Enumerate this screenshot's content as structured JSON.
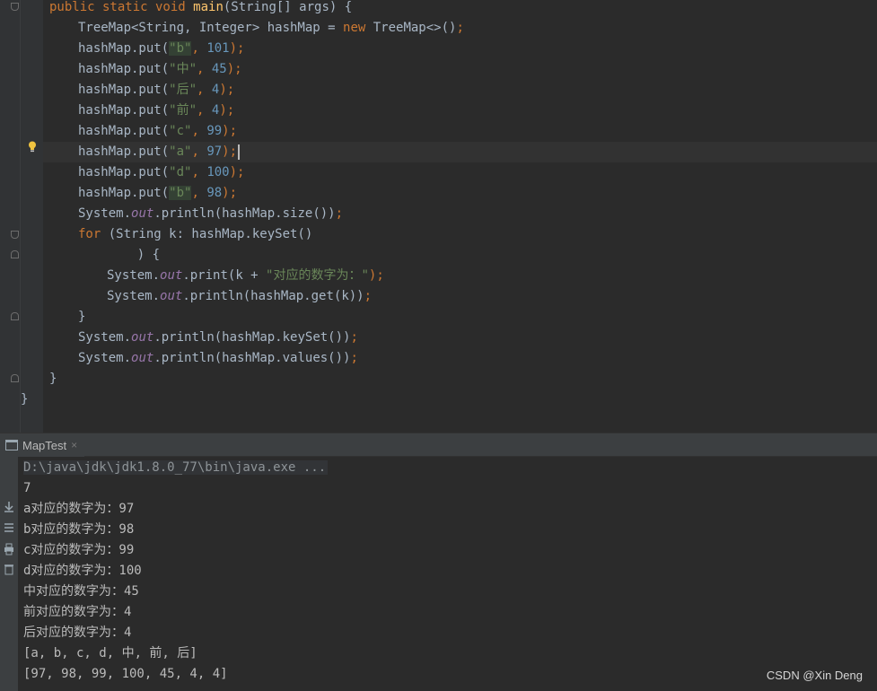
{
  "editor": {
    "lines": [
      [
        {
          "t": "public static void ",
          "c": "kw"
        },
        {
          "t": "main",
          "c": "fn"
        },
        {
          "t": "(String[] args) {",
          "c": "pl"
        }
      ],
      [
        {
          "t": "TreeMap<String, Integer> hashMap = ",
          "c": "pl"
        },
        {
          "t": "new ",
          "c": "kw"
        },
        {
          "t": "TreeMap<>()",
          "c": "pl"
        },
        {
          "t": ";",
          "c": "kw"
        }
      ],
      [
        {
          "t": "hashMap.put(",
          "c": "pl"
        },
        {
          "t": "\"b\"",
          "c": "str",
          "hl": true
        },
        {
          "t": ", ",
          "c": "kw"
        },
        {
          "t": "101",
          "c": "num"
        },
        {
          "t": ");",
          "c": "kw"
        }
      ],
      [
        {
          "t": "hashMap.put(",
          "c": "pl"
        },
        {
          "t": "\"中\"",
          "c": "str"
        },
        {
          "t": ", ",
          "c": "kw"
        },
        {
          "t": "45",
          "c": "num"
        },
        {
          "t": ");",
          "c": "kw"
        }
      ],
      [
        {
          "t": "hashMap.put(",
          "c": "pl"
        },
        {
          "t": "\"后\"",
          "c": "str"
        },
        {
          "t": ", ",
          "c": "kw"
        },
        {
          "t": "4",
          "c": "num"
        },
        {
          "t": ");",
          "c": "kw"
        }
      ],
      [
        {
          "t": "hashMap.put(",
          "c": "pl"
        },
        {
          "t": "\"前\"",
          "c": "str"
        },
        {
          "t": ", ",
          "c": "kw"
        },
        {
          "t": "4",
          "c": "num"
        },
        {
          "t": ");",
          "c": "kw"
        }
      ],
      [
        {
          "t": "hashMap.put(",
          "c": "pl"
        },
        {
          "t": "\"c\"",
          "c": "str"
        },
        {
          "t": ", ",
          "c": "kw"
        },
        {
          "t": "99",
          "c": "num"
        },
        {
          "t": ");",
          "c": "kw"
        }
      ],
      [
        {
          "t": "hashMap.put(",
          "c": "pl"
        },
        {
          "t": "\"a\"",
          "c": "str"
        },
        {
          "t": ", ",
          "c": "kw"
        },
        {
          "t": "97",
          "c": "num"
        },
        {
          "t": ");",
          "c": "kw"
        }
      ],
      [
        {
          "t": "hashMap.put(",
          "c": "pl"
        },
        {
          "t": "\"d\"",
          "c": "str"
        },
        {
          "t": ", ",
          "c": "kw"
        },
        {
          "t": "100",
          "c": "num"
        },
        {
          "t": ");",
          "c": "kw"
        }
      ],
      [
        {
          "t": "hashMap.put(",
          "c": "pl"
        },
        {
          "t": "\"b\"",
          "c": "str",
          "hl": true
        },
        {
          "t": ", ",
          "c": "kw"
        },
        {
          "t": "98",
          "c": "num"
        },
        {
          "t": ");",
          "c": "kw"
        }
      ],
      [
        {
          "t": "System.",
          "c": "pl"
        },
        {
          "t": "out",
          "c": "fld"
        },
        {
          "t": ".println(hashMap.size())",
          "c": "pl"
        },
        {
          "t": ";",
          "c": "kw"
        }
      ],
      [
        {
          "t": "for ",
          "c": "kw"
        },
        {
          "t": "(String k: hashMap.keySet()",
          "c": "pl"
        }
      ],
      [
        {
          "t": "    ) {",
          "c": "pl"
        }
      ],
      [
        {
          "t": "System.",
          "c": "pl"
        },
        {
          "t": "out",
          "c": "fld"
        },
        {
          "t": ".print(k + ",
          "c": "pl"
        },
        {
          "t": "\"对应的数字为：\"",
          "c": "str"
        },
        {
          "t": ");",
          "c": "kw"
        }
      ],
      [
        {
          "t": "System.",
          "c": "pl"
        },
        {
          "t": "out",
          "c": "fld"
        },
        {
          "t": ".println(hashMap.get(k))",
          "c": "pl"
        },
        {
          "t": ";",
          "c": "kw"
        }
      ],
      [
        {
          "t": "}",
          "c": "pl"
        }
      ],
      [
        {
          "t": "System.",
          "c": "pl"
        },
        {
          "t": "out",
          "c": "fld"
        },
        {
          "t": ".println(hashMap.keySet())",
          "c": "pl"
        },
        {
          "t": ";",
          "c": "kw"
        }
      ],
      [
        {
          "t": "System.",
          "c": "pl"
        },
        {
          "t": "out",
          "c": "fld"
        },
        {
          "t": ".println(hashMap.values())",
          "c": "pl"
        },
        {
          "t": ";",
          "c": "kw"
        }
      ],
      [
        {
          "t": "}",
          "c": "pl"
        }
      ],
      [
        {
          "t": "}",
          "c": "pl"
        }
      ]
    ],
    "indents": [
      1,
      2,
      2,
      2,
      2,
      2,
      2,
      2,
      2,
      2,
      2,
      2,
      3,
      3,
      3,
      2,
      2,
      2,
      1,
      0
    ],
    "caret_line": 7
  },
  "run": {
    "tab_label": "MapTest",
    "tab_close": "×",
    "command": "D:\\java\\jdk\\jdk1.8.0_77\\bin\\java.exe ...",
    "output": [
      "7",
      "a对应的数字为：97",
      "b对应的数字为：98",
      "c对应的数字为：99",
      "d对应的数字为：100",
      "中对应的数字为：45",
      "前对应的数字为：4",
      "后对应的数字为：4",
      "[a, b, c, d, 中, 前, 后]",
      "[97, 98, 99, 100, 45, 4, 4]"
    ]
  },
  "watermark": "CSDN @Xin Deng",
  "colors": {
    "keyword": "#cc7832",
    "method": "#ffc66d",
    "string": "#6a8759",
    "number": "#6897bb",
    "field": "#9876aa",
    "plain": "#a9b7c6"
  }
}
